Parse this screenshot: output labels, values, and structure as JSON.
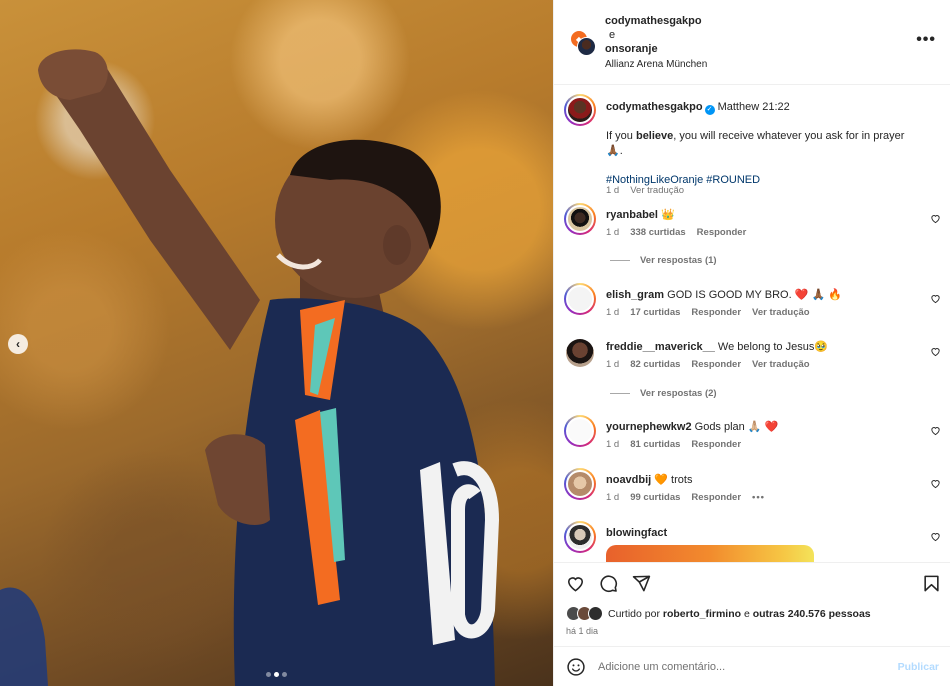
{
  "header": {
    "username1": "codymathesgakpo",
    "connector": "e",
    "username2": "onsoranje",
    "location": "Allianz Arena München",
    "more_icon": "more-horizontal-icon"
  },
  "caption": {
    "username": "codymathesgakpo",
    "text_prefix": "Matthew 21:22",
    "line2_a": "If you ",
    "line2_bold": "believe",
    "line2_b": ", you will receive whatever you ask for in prayer 🙏🏾.",
    "hashtags": "#NothingLikeOranje #ROUNED",
    "time": "1 d",
    "translate": "Ver tradução"
  },
  "comments": [
    {
      "username": "ryanbabel",
      "text": "👑",
      "time": "1 d",
      "likes": "338 curtidas",
      "reply": "Responder",
      "view_replies": "Ver respostas (1)"
    },
    {
      "username": "elish_gram",
      "text": "GOD IS GOOD MY BRO. ❤️ 🙏🏾 🔥",
      "time": "1 d",
      "likes": "17 curtidas",
      "reply": "Responder",
      "translate": "Ver tradução"
    },
    {
      "username": "freddie__maverick__",
      "text": "We belong to Jesus🥹",
      "time": "1 d",
      "likes": "82 curtidas",
      "reply": "Responder",
      "translate": "Ver tradução",
      "view_replies": "Ver respostas (2)"
    },
    {
      "username": "yournephewkw2",
      "text": "Gods plan 🙏🏼 ❤️",
      "time": "1 d",
      "likes": "81 curtidas",
      "reply": "Responder"
    },
    {
      "username": "noavdbij",
      "text": "🧡 trots",
      "time": "1 d",
      "likes": "99 curtidas",
      "reply": "Responder",
      "more": "•••"
    },
    {
      "username": "blowingfact",
      "text": ""
    }
  ],
  "actions": {
    "liked_by_prefix": "Curtido por",
    "liked_by_user": "roberto_firmino",
    "liked_by_mid": "e",
    "liked_by_others": "outras 240.576 pessoas",
    "time_ago": "há 1 dia"
  },
  "comment_box": {
    "placeholder": "Adicione um comentário...",
    "publish": "Publicar"
  },
  "carousel": {
    "total": 3,
    "active": 2
  },
  "colors": {
    "accent": "#0095f6",
    "hashtag": "#00376b",
    "muted": "#737373",
    "jersey": "#1b2a52",
    "orange": "#f36c21"
  }
}
